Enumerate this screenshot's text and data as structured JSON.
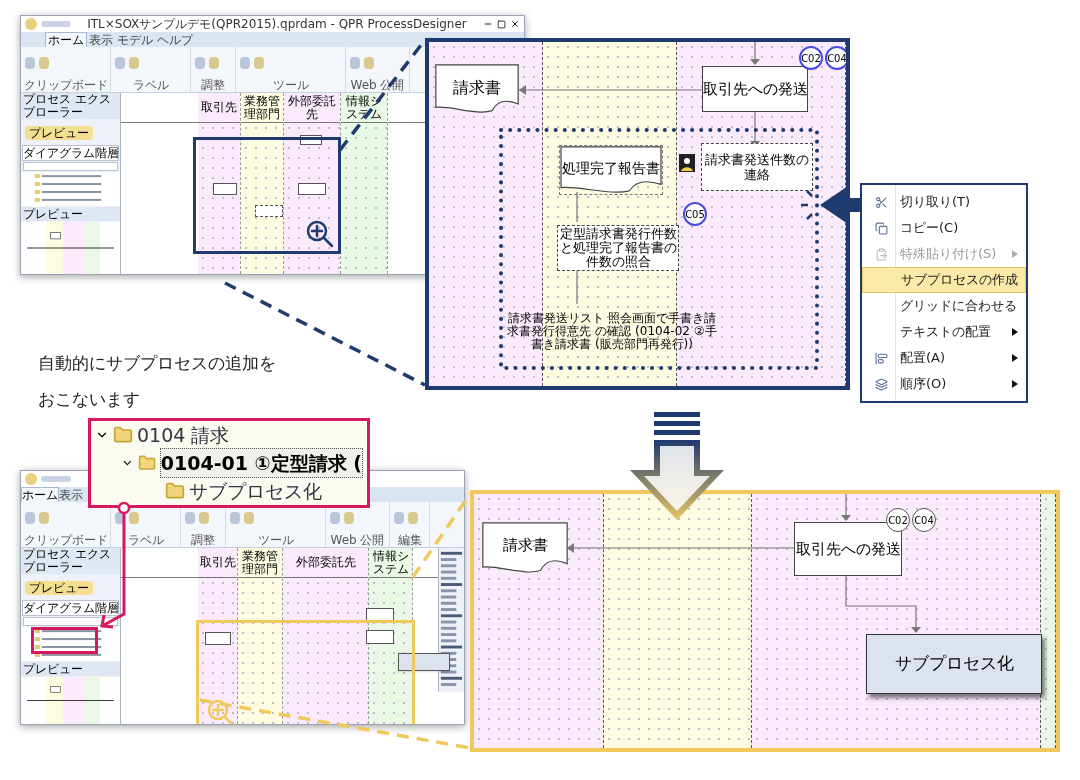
{
  "top_window": {
    "title": "ITL×SOXサンプルデモ(QPR2015).qprdam - QPR ProcessDesigner",
    "tabs": [
      {
        "label": "ホーム",
        "selected": true
      },
      {
        "label": "表示",
        "selected": false
      },
      {
        "label": "モデル",
        "selected": false
      },
      {
        "label": "ヘルプ",
        "selected": false
      }
    ],
    "ribbon_groups": [
      "クリップボード",
      "ラベル",
      "調整",
      "ツール",
      "Web 公開"
    ],
    "explorer_title": "プロセス エクスプローラー",
    "preview_button": "プレビュー",
    "hierarchy_select": "ダイアグラム階層",
    "preview_title": "プレビュー",
    "lanes": [
      {
        "label": "取引先",
        "color": "#fbeafb"
      },
      {
        "label": "業務管理部門",
        "color": "#fdfbe0"
      },
      {
        "label": "外部委託先",
        "color": "#fbeafb"
      },
      {
        "label": "情報システム",
        "color": "#eaf8e6"
      }
    ]
  },
  "detail_before": {
    "lanes": [
      {
        "color": "#fbeafb"
      },
      {
        "color": "#fdfbe0"
      },
      {
        "color": "#fbeafb"
      }
    ],
    "document": "請求書",
    "send_step": "取引先への発送",
    "controls": [
      "C02",
      "C04"
    ],
    "report_document": "処理完了報告書",
    "notify_step": "請求書発送件数の連絡",
    "check_step": "定型請求書発行件数と処理完了報告書の件数の照合",
    "check_control": "C05",
    "note": "請求書発送リスト 照会画面で手書き請求書発行得意先 の確認 (0104-02 ②手書き請求書 (販売部門再発行))"
  },
  "context_menu": [
    {
      "label": "切り取り(T)",
      "disabled": false,
      "highlighted": false,
      "submenu": false
    },
    {
      "label": "コピー(C)",
      "disabled": false,
      "highlighted": false,
      "submenu": false
    },
    {
      "label": "特殊貼り付け(S)",
      "disabled": true,
      "highlighted": false,
      "submenu": true
    },
    {
      "label": "サブプロセスの作成",
      "disabled": false,
      "highlighted": true,
      "submenu": false
    },
    {
      "label": "グリッドに合わせる",
      "disabled": false,
      "highlighted": false,
      "submenu": false
    },
    {
      "label": "テキストの配置",
      "disabled": false,
      "highlighted": false,
      "submenu": true
    },
    {
      "label": "配置(A)",
      "disabled": false,
      "highlighted": false,
      "submenu": true
    },
    {
      "label": "順序(O)",
      "disabled": false,
      "highlighted": false,
      "submenu": true
    }
  ],
  "caption": [
    "自動的にサブプロセスの追加を",
    "おこないます"
  ],
  "tree_callout": {
    "items": [
      {
        "label": "0104 請求",
        "expanded": true,
        "selected": false,
        "children": [
          {
            "label": "0104-01 ①定型請求 (",
            "expanded": true,
            "selected": true,
            "children": [
              {
                "label": "サブプロセス化",
                "selected": false
              }
            ]
          }
        ]
      }
    ]
  },
  "bottom_window": {
    "tabs": [
      {
        "label": "ホーム",
        "selected": true
      },
      {
        "label": "表示",
        "selected": false
      }
    ],
    "ribbon_groups": [
      "クリップボード",
      "ラベル",
      "調整",
      "ツール",
      "Web 公開",
      "編集"
    ],
    "explorer_title": "プロセス エクスプローラー",
    "preview_button": "プレビュー",
    "hierarchy_select": "ダイアグラム階層",
    "preview_title": "プレビュー",
    "lanes": [
      {
        "label": "取引先",
        "color": "#fbeafb"
      },
      {
        "label": "業務管理部門",
        "color": "#fdfbe0"
      },
      {
        "label": "外部委託先",
        "color": "#fbeafb"
      },
      {
        "label": "情報システム",
        "color": "#eaf8e6"
      }
    ]
  },
  "detail_after": {
    "lanes": [
      {
        "color": "#fbeafb"
      },
      {
        "color": "#fdfbe0"
      },
      {
        "color": "#fbeafb"
      },
      {
        "color": "#eaf8e6"
      }
    ],
    "document": "請求書",
    "send_step": "取引先への発送",
    "controls": [
      "C02",
      "C04"
    ],
    "subprocess": "サブプロセス化"
  }
}
